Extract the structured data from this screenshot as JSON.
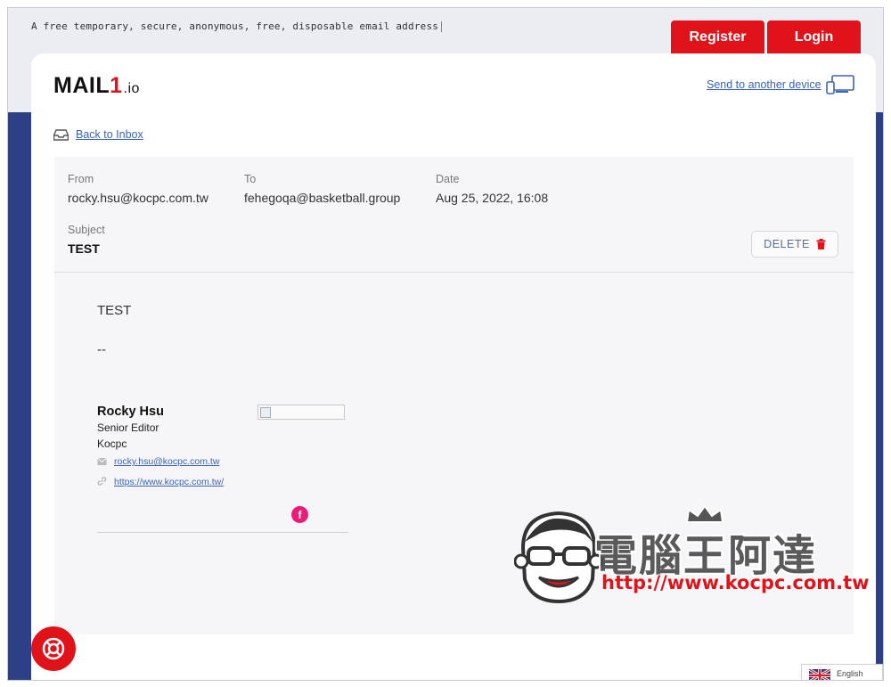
{
  "header": {
    "tagline": "A free temporary, secure, anonymous, free, disposable email address",
    "register_label": "Register",
    "login_label": "Login"
  },
  "brand": {
    "logo_main": "MAIL",
    "logo_one": "1",
    "logo_suffix": ".io",
    "send_device_label": "Send to another device"
  },
  "nav": {
    "back_label": "Back to Inbox"
  },
  "email": {
    "from_label": "From",
    "from_value": "rocky.hsu@kocpc.com.tw",
    "to_label": "To",
    "to_value": "fehegoqa@basketball.group",
    "date_label": "Date",
    "date_value": "Aug 25, 2022, 16:08",
    "subject_label": "Subject",
    "subject_value": "TEST",
    "delete_label": "DELETE",
    "body_line": "TEST",
    "body_separator": "--"
  },
  "signature": {
    "name": "Rocky Hsu",
    "title": "Senior Editor",
    "company": "Kocpc",
    "email": "rocky.hsu@kocpc.com.tw",
    "website": "https://www.kocpc.com.tw/",
    "facebook_glyph": "f"
  },
  "watermark": {
    "title": "電腦王阿達",
    "url": "http://www.kocpc.com.tw"
  },
  "language": {
    "current": "English"
  },
  "colors": {
    "accent": "#e0131a",
    "navy": "#2d3f86",
    "link": "#3b63b5",
    "facebook_pink": "#ec1b7a"
  }
}
